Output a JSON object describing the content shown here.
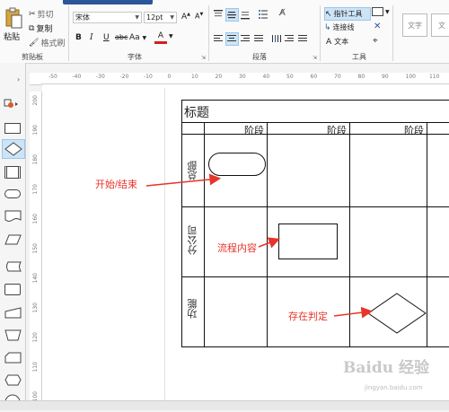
{
  "clipboard": {
    "paste": "粘贴",
    "cut": "剪切",
    "copy": "复制",
    "format_painter": "格式刷",
    "label": "剪贴板"
  },
  "font": {
    "family": "宋体",
    "size": "12pt",
    "bold": "B",
    "italic": "I",
    "underline": "U",
    "strike": "abc",
    "case": "Aa",
    "color_letter": "A",
    "grow": "A",
    "shrink": "A",
    "label": "字体"
  },
  "paragraph": {
    "label": "段落"
  },
  "tools": {
    "pointer": "指针工具",
    "connector": "连接线",
    "text": "文本",
    "label": "工具"
  },
  "styles": {
    "style1": "文字",
    "style2": "文"
  },
  "hruler_ticks": [
    "-50",
    "-40",
    "-30",
    "-20",
    "-10",
    "0",
    "10",
    "20",
    "30",
    "40",
    "50",
    "60",
    "70",
    "80",
    "90",
    "100",
    "110"
  ],
  "vruler_ticks": [
    "200",
    "190",
    "180",
    "170",
    "160",
    "150",
    "140",
    "130",
    "120",
    "110",
    "100"
  ],
  "diagram": {
    "title": "标题",
    "phase_headers": [
      "阶段",
      "阶段",
      "阶段"
    ],
    "lanes": [
      "总部",
      "分公司",
      "功能"
    ]
  },
  "annotations": {
    "start_end": "开始/结束",
    "process": "流程内容",
    "decision": "存在判定"
  },
  "watermark": {
    "brand": "Baidu 经验",
    "url": "jingyan.baidu.com"
  },
  "colors": {
    "annotation": "#e8342a",
    "accent": "#2b579a"
  }
}
